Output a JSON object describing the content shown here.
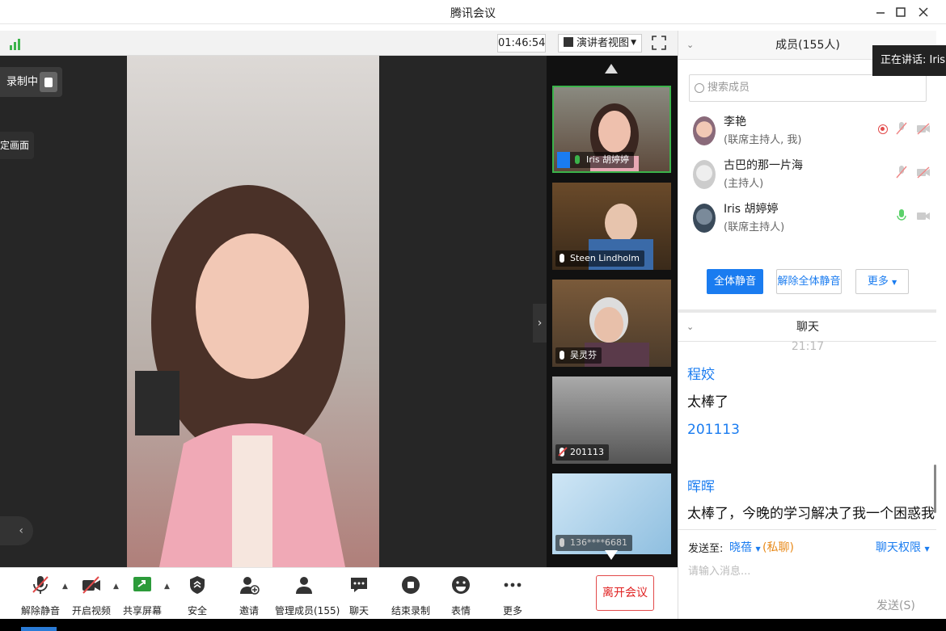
{
  "window": {
    "title": "腾讯会议",
    "minimize_icon": "minimize-icon",
    "maximize_icon": "maximize-icon",
    "close_icon": "close-icon"
  },
  "meeting": {
    "elapsed": "01:46:54",
    "view_mode": "演讲者视图",
    "recording_label": "录制中",
    "pin_label": "定画面"
  },
  "thumbnails": [
    {
      "name": "Iris 胡婷婷",
      "active": true,
      "muted": false
    },
    {
      "name": "Steen Lindholm",
      "active": false,
      "muted": false
    },
    {
      "name": "吴灵芬",
      "active": false,
      "muted": false
    },
    {
      "name": "201113",
      "active": false,
      "muted": true
    },
    {
      "name": "136****6681",
      "active": false,
      "muted": true
    }
  ],
  "toolbar": {
    "unmute": "解除静音",
    "video": "开启视频",
    "share": "共享屏幕",
    "security": "安全",
    "invite": "邀请",
    "manage": "管理成员(155)",
    "chat": "聊天",
    "stop_record": "结束录制",
    "emoji": "表情",
    "more": "更多",
    "leave": "离开会议"
  },
  "members": {
    "header": "成员(155人)",
    "speaking_tip": "正在讲话: Iris 胡",
    "search_placeholder": "搜索成员",
    "list": [
      {
        "name": "李艳",
        "role": "(联席主持人, 我)"
      },
      {
        "name": "古巴的那一片海",
        "role": "(主持人)"
      },
      {
        "name": "Iris 胡婷婷",
        "role": "(联席主持人)"
      }
    ],
    "mute_all": "全体静音",
    "unmute_all": "解除全体静音",
    "more": "更多"
  },
  "chat": {
    "header": "聊天",
    "time": "21:17",
    "messages": [
      {
        "sender": "程姣",
        "text": "太棒了"
      },
      {
        "sender": "201113",
        "text": ""
      },
      {
        "sender": "晖晖",
        "text": "太棒了，今晚的学习解决了我一个困惑我好久的"
      }
    ],
    "send_to_label": "发送至:",
    "send_to_target": "晓蓓",
    "send_to_private": "(私聊)",
    "permission": "聊天权限",
    "input_placeholder": "请输入消息...",
    "send_button": "发送(S)"
  },
  "colors": {
    "accent": "#1a7cf0",
    "danger": "#e02020",
    "private": "#e88a1a",
    "active_speaker": "#3bb34a"
  }
}
